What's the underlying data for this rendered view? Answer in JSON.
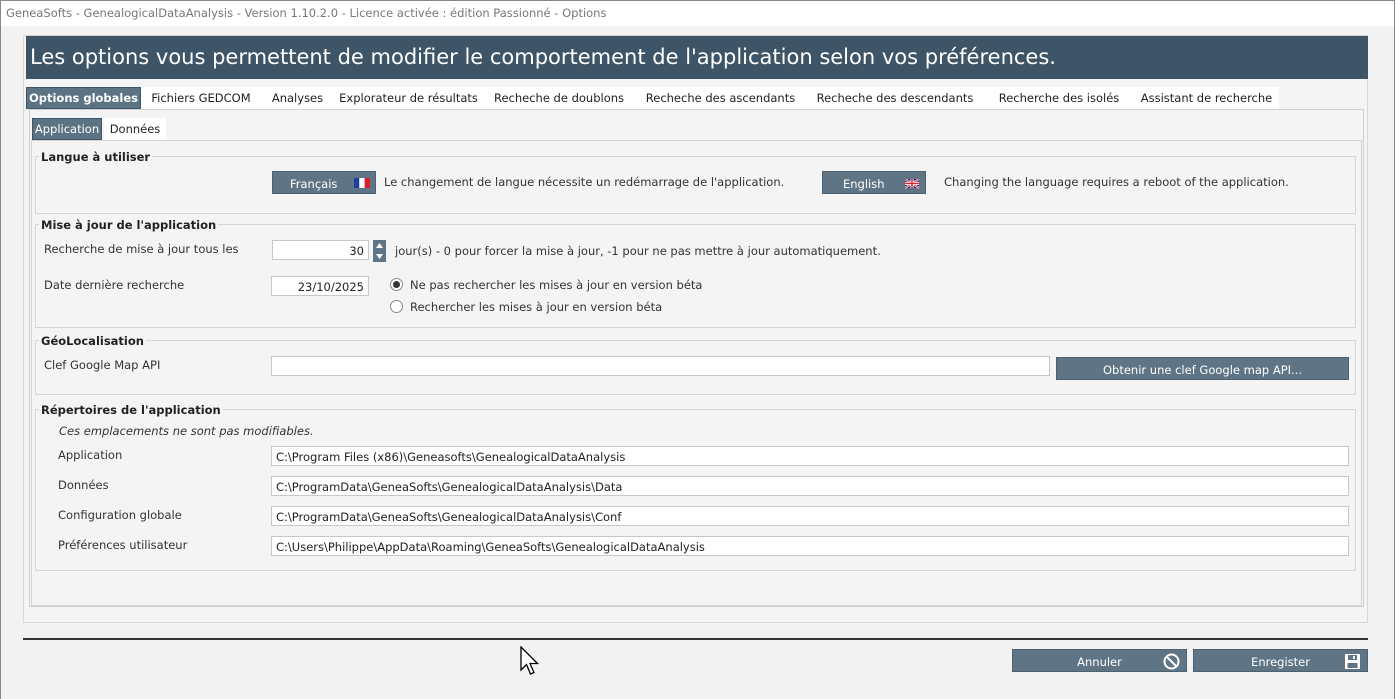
{
  "window": {
    "title": "GeneaSofts - GenealogicalDataAnalysis - Version 1.10.2.0 - Licence activée : édition Passionné -  Options"
  },
  "banner": {
    "text": "Les options vous permettent de modifier le comportement de l'application selon vos préférences."
  },
  "tabs": [
    {
      "label": "Options globales",
      "active": true
    },
    {
      "label": "Fichiers GEDCOM"
    },
    {
      "label": "Analyses"
    },
    {
      "label": "Explorateur de résultats"
    },
    {
      "label": "Recheche de doublons"
    },
    {
      "label": "Recheche des ascendants"
    },
    {
      "label": "Recheche des descendants"
    },
    {
      "label": "Recherche des isolés"
    },
    {
      "label": "Assistant de recherche"
    }
  ],
  "subtabs": [
    {
      "label": "Application",
      "active": true
    },
    {
      "label": "Données"
    }
  ],
  "language": {
    "title": "Langue à utiliser",
    "fr_button": "Français",
    "fr_note": "Le changement de langue nécessite un redémarrage de l'application.",
    "en_button": "English",
    "en_note": "Changing the language requires a reboot of the application."
  },
  "update": {
    "title": "Mise à jour de l'application",
    "interval_label": "Recherche de mise à jour tous les",
    "interval_value": "30",
    "interval_hint": "jour(s) - 0 pour forcer la mise à jour, -1 pour ne pas mettre à jour automatiquement.",
    "last_date_label": "Date dernière recherche",
    "last_date_value": "23/10/2025",
    "beta_off_label": "Ne pas rechercher les mises à jour en version béta",
    "beta_on_label": "Rechercher les mises à jour en version béta",
    "beta_selected": "off"
  },
  "geo": {
    "title": "GéoLocalisation",
    "api_label": "Clef Google Map API",
    "api_value": "",
    "api_button": "Obtenir une clef Google map API..."
  },
  "directories": {
    "title": "Répertoires de l'application",
    "note": "Ces emplacements ne sont pas modifiables.",
    "application_label": "Application",
    "application_value": "C:\\Program Files (x86)\\Geneasofts\\GenealogicalDataAnalysis",
    "data_label": "Données",
    "data_value": "C:\\ProgramData\\GeneaSofts\\GenealogicalDataAnalysis\\Data",
    "config_label": "Configuration globale",
    "config_value": "C:\\ProgramData\\GeneaSofts\\GenealogicalDataAnalysis\\Conf",
    "prefs_label": "Préférences utilisateur",
    "prefs_value": "C:\\Users\\Philippe\\AppData\\Roaming\\GeneaSofts\\GenealogicalDataAnalysis"
  },
  "footer": {
    "cancel_label": "Annuler",
    "save_label": "Enregister"
  },
  "colors": {
    "banner": "#3d5567",
    "button": "#5f7585",
    "active_tab": "#5c7384"
  }
}
